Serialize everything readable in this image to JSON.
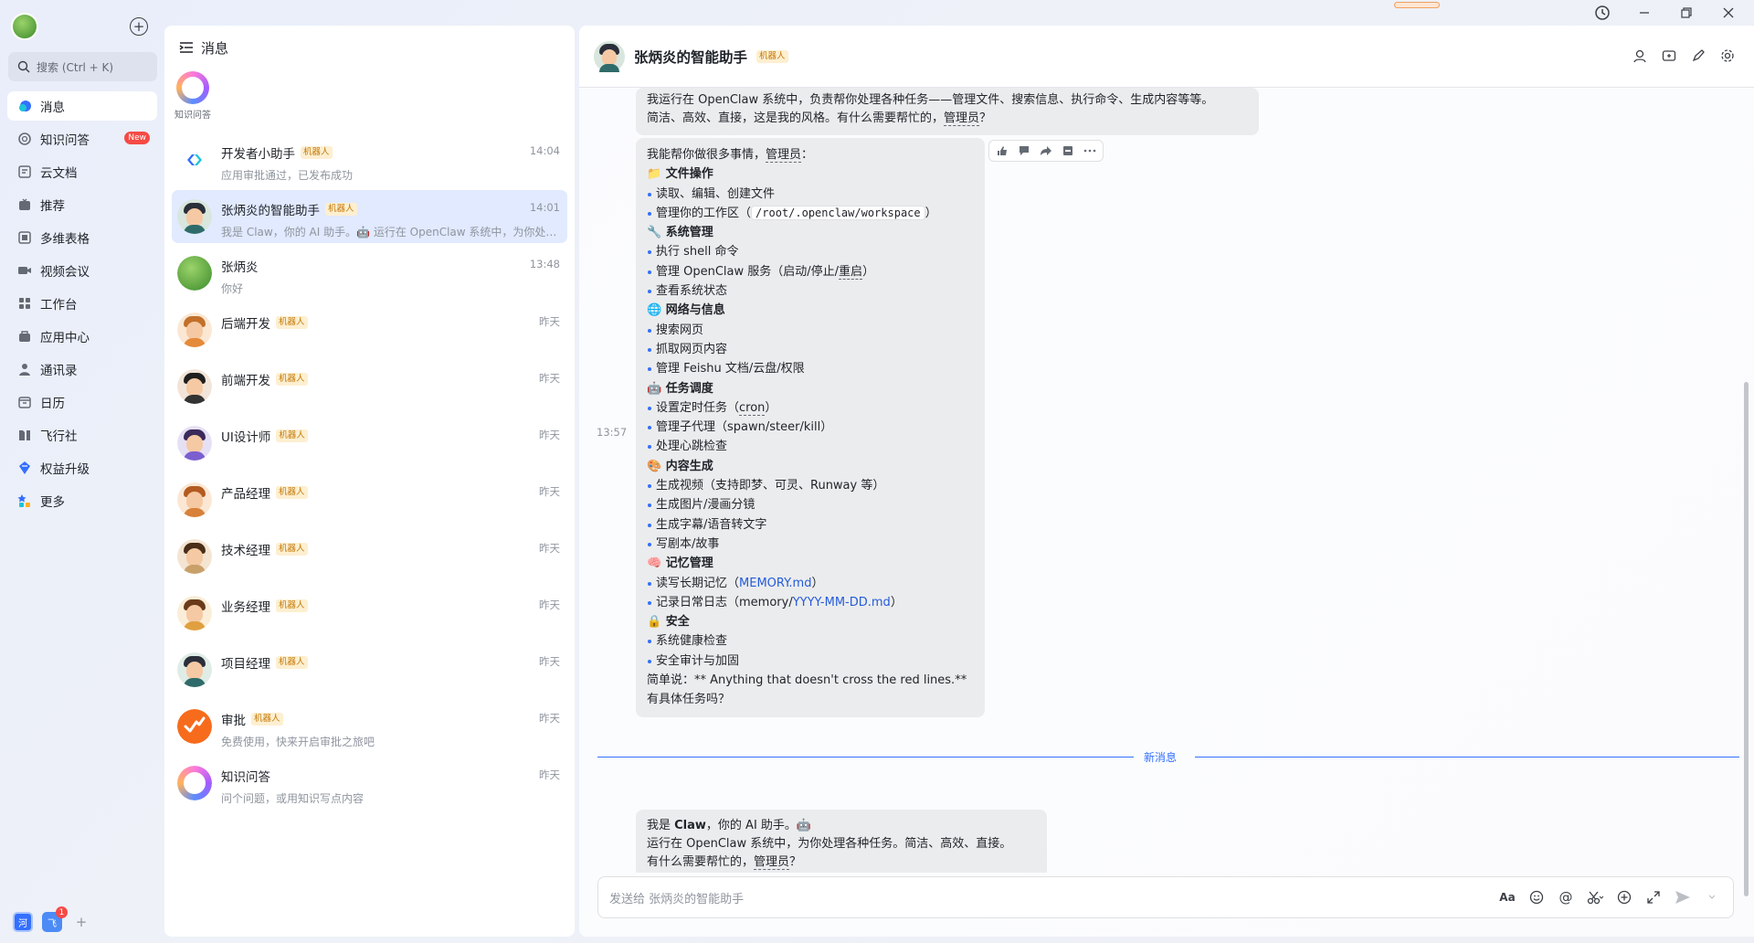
{
  "app": {
    "window_controls": [
      "history",
      "minimize",
      "restore",
      "close"
    ]
  },
  "nav": {
    "search_placeholder": "搜索 (Ctrl + K)",
    "items": [
      {
        "label": "消息",
        "icon": "message-icon",
        "active": true
      },
      {
        "label": "知识问答",
        "icon": "knowledge-icon",
        "badge": "New"
      },
      {
        "label": "云文档",
        "icon": "docs-icon"
      },
      {
        "label": "推荐",
        "icon": "recommend-icon"
      },
      {
        "label": "多维表格",
        "icon": "base-icon"
      },
      {
        "label": "视频会议",
        "icon": "video-icon"
      },
      {
        "label": "工作台",
        "icon": "workplace-icon"
      },
      {
        "label": "应用中心",
        "icon": "app-center-icon"
      },
      {
        "label": "通讯录",
        "icon": "contacts-icon"
      },
      {
        "label": "日历",
        "icon": "calendar-icon"
      },
      {
        "label": "飞行社",
        "icon": "club-icon"
      },
      {
        "label": "权益升级",
        "icon": "upgrade-icon"
      },
      {
        "label": "更多",
        "icon": "more-apps-icon"
      }
    ],
    "bottom": {
      "a": "河",
      "b": "飞",
      "b_badge": "1"
    }
  },
  "list": {
    "header": "消息",
    "pinned_label": "知识问答",
    "chats": [
      {
        "name": "开发者小助手",
        "tag": "机器人",
        "time": "14:04",
        "sub": "应用审批通过，已发布成功"
      },
      {
        "name": "张炳炎的智能助手",
        "tag": "机器人",
        "time": "14:01",
        "sub": "我是 Claw，你的 AI 助手。🤖 运行在 OpenClaw 系统中，为你处理..."
      },
      {
        "name": "张炳炎",
        "tag": "",
        "time": "13:48",
        "sub": "你好"
      },
      {
        "name": "后端开发",
        "tag": "机器人",
        "time": "昨天",
        "sub": ""
      },
      {
        "name": "前端开发",
        "tag": "机器人",
        "time": "昨天",
        "sub": ""
      },
      {
        "name": "UI设计师",
        "tag": "机器人",
        "time": "昨天",
        "sub": ""
      },
      {
        "name": "产品经理",
        "tag": "机器人",
        "time": "昨天",
        "sub": ""
      },
      {
        "name": "技术经理",
        "tag": "机器人",
        "time": "昨天",
        "sub": ""
      },
      {
        "name": "业务经理",
        "tag": "机器人",
        "time": "昨天",
        "sub": ""
      },
      {
        "name": "项目经理",
        "tag": "机器人",
        "time": "昨天",
        "sub": ""
      },
      {
        "name": "审批",
        "tag": "机器人",
        "time": "昨天",
        "sub": "免费使用，快来开启审批之旅吧"
      },
      {
        "name": "知识问答",
        "tag": "",
        "time": "昨天",
        "sub": "问个问题，或用知识写点内容"
      }
    ]
  },
  "conv": {
    "title": "张炳炎的智能助手",
    "tag": "机器人",
    "msg1_line1": "我运行在 OpenClaw 系统中，负责帮你处理各种任务——管理文件、搜索信息、执行命令、生成内容等等。",
    "msg1_line2a": "简洁、高效、直接，这是我的风格。有什么需要帮忙的，",
    "msg1_line2b": "管理员",
    "msg1_line2c": "？",
    "timestamp": "13:57",
    "msg2": {
      "intro_a": "我能帮你做很多事情，",
      "intro_b": "管理员",
      "intro_c": "：",
      "s1": "📁 文件操作",
      "s1_l1": "读取、编辑、创建文件",
      "s1_l2a": "管理你的工作区（",
      "s1_l2_code": "/root/.openclaw/workspace",
      "s1_l2c": "）",
      "s2": "🔧 系统管理",
      "s2_l1": "执行 shell 命令",
      "s2_l2a": "管理 OpenClaw 服务（启动/停止/",
      "s2_l2b": "重启",
      "s2_l2c": "）",
      "s2_l3": "查看系统状态",
      "s3": "🌐 网络与信息",
      "s3_l1": "搜索网页",
      "s3_l2": "抓取网页内容",
      "s3_l3": "管理 Feishu 文档/云盘/权限",
      "s4": "🤖 任务调度",
      "s4_l1a": "设置定时任务（",
      "s4_l1b": "cron",
      "s4_l1c": "）",
      "s4_l2": "管理子代理（spawn/steer/kill）",
      "s4_l3": "处理心跳检查",
      "s5": "🎨 内容生成",
      "s5_l1": "生成视频（支持即梦、可灵、Runway 等）",
      "s5_l2": "生成图片/漫画分镜",
      "s5_l3": "生成字幕/语音转文字",
      "s5_l4": "写剧本/故事",
      "s6": "🧠 记忆管理",
      "s6_l1a": "读写长期记忆（",
      "s6_l1b": "MEMORY.md",
      "s6_l1c": "）",
      "s6_l2a": "记录日常日志（memory/",
      "s6_l2b": "YYYY-MM-DD.md",
      "s6_l2c": "）",
      "s7": "🔒 安全",
      "s7_l1": "系统健康检查",
      "s7_l2": "安全审计与加固",
      "outro1": "简单说：** Anything that doesn't cross the red lines.**",
      "outro2": "有具体任务吗？"
    },
    "new_messages": "新消息",
    "msg3_line1a": "我是 ",
    "msg3_line1b": "Claw",
    "msg3_line1c": "，你的 AI 助手。🤖",
    "msg3_line2": "运行在 OpenClaw 系统中，为你处理各种任务。简洁、高效、直接。",
    "msg3_line3a": "有什么需要帮忙的，",
    "msg3_line3b": "管理员",
    "msg3_line3c": "？",
    "composer_placeholder": "发送给 张炳炎的智能助手"
  },
  "colors": {
    "accent": "#3370ff",
    "bubble": "#ebeced",
    "selected": "#e1eaff",
    "badge": "#f54a45"
  }
}
